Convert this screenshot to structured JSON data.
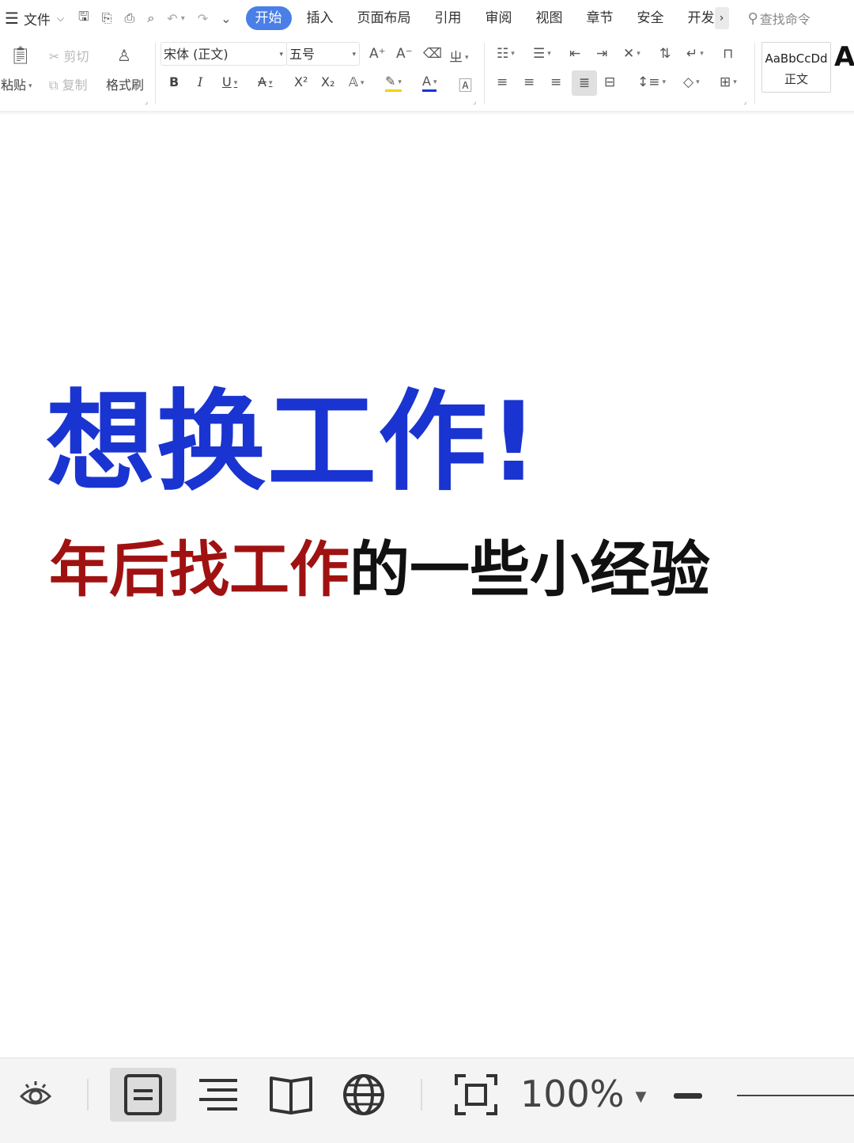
{
  "menubar": {
    "file_label": "文件",
    "tabs": [
      {
        "label": "开始",
        "active": true
      },
      {
        "label": "插入"
      },
      {
        "label": "页面布局"
      },
      {
        "label": "引用"
      },
      {
        "label": "审阅"
      },
      {
        "label": "视图"
      },
      {
        "label": "章节"
      },
      {
        "label": "安全"
      },
      {
        "label": "开发工"
      }
    ],
    "more_symbol": "›",
    "search_placeholder": "查找命令"
  },
  "ribbon": {
    "paste_label": "粘贴",
    "cut_label": "剪切",
    "copy_label": "复制",
    "format_painter_label": "格式刷",
    "font_name": "宋体 (正文)",
    "font_size": "五号",
    "style_sample": "AaBbCcDd",
    "style_name": "正文",
    "style_next_sample": "A"
  },
  "document": {
    "title": "想换工作!",
    "subtitle_red": "年后找工作",
    "subtitle_black": "的一些小经验",
    "title_color": "#1a34d1",
    "subtitle_red_color": "#a01212"
  },
  "statusbar": {
    "zoom_label": "100%"
  },
  "colors": {
    "accent": "#4a7fe8"
  }
}
